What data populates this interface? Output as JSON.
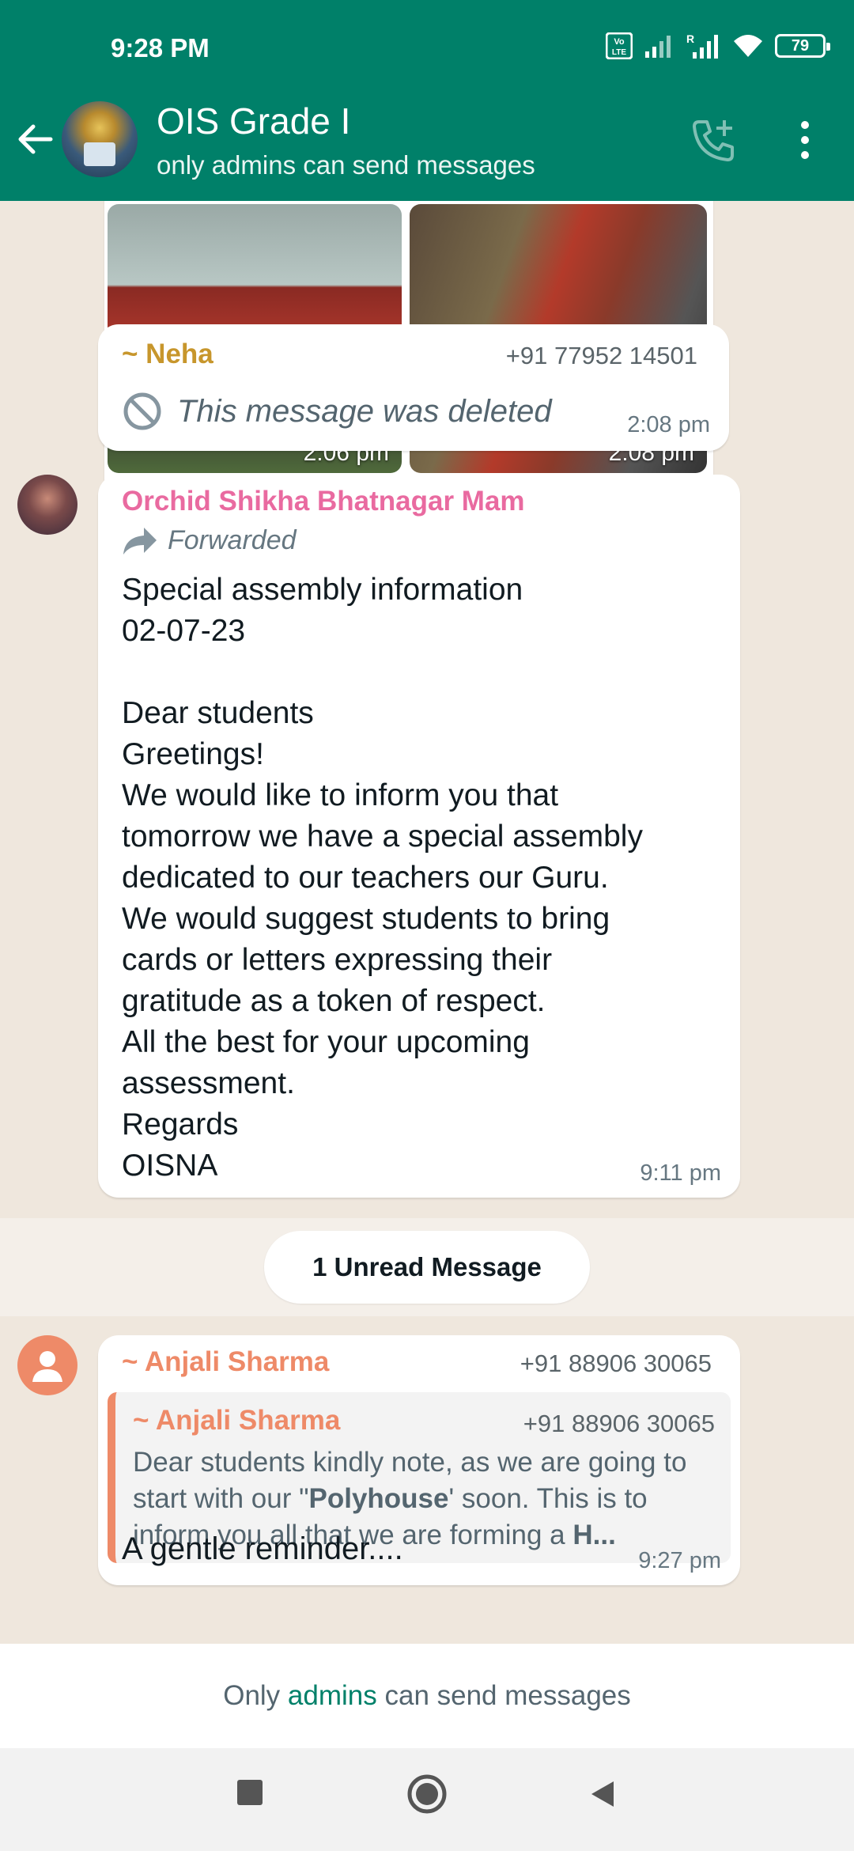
{
  "status_bar": {
    "time": "9:28 PM",
    "battery": "79",
    "volte": "LTE",
    "roaming": "R"
  },
  "header": {
    "title": "OIS Grade I",
    "subtitle": "only admins can send messages"
  },
  "messages": {
    "photo1_time": "2:06 pm",
    "photo2_time": "2:08 pm",
    "neha": {
      "sender": "~ Neha",
      "phone": "+91 77952 14501",
      "text": "This message was deleted",
      "time": "2:08 pm"
    },
    "orchid": {
      "sender": "Orchid Shikha Bhatnagar Mam",
      "forwarded": "Forwarded",
      "body": "Special assembly information\n02-07-23\n\nDear students\nGreetings!\nWe would like to inform you that\ntomorrow we have a special assembly\ndedicated to our teachers our Guru.\nWe would suggest students to bring\ncards or letters expressing their\ngratitude as a token of respect.\nAll the best for your upcoming\nassessment.\nRegards\nOISNA",
      "time": "9:11 pm"
    },
    "unread": "1 Unread Message",
    "anjali": {
      "sender": "~ Anjali Sharma",
      "phone": "+91 88906 30065",
      "quote_sender": "~ Anjali Sharma",
      "quote_phone": "+91 88906 30065",
      "quote_part1": "Dear students kindly note, as we are going to start with our \"",
      "quote_bold": "Polyhouse",
      "quote_part2": "' soon. This is to inform you all that we are forming a ",
      "quote_bold2": "H...",
      "text": "A gentle reminder....",
      "time": "9:27 pm"
    }
  },
  "footer": {
    "prefix": "Only ",
    "link": "admins",
    "suffix": " can send messages"
  },
  "colors": {
    "header": "#008069",
    "neha": "#c7962c",
    "orchid": "#e96aa0",
    "anjali": "#ee8a68"
  }
}
